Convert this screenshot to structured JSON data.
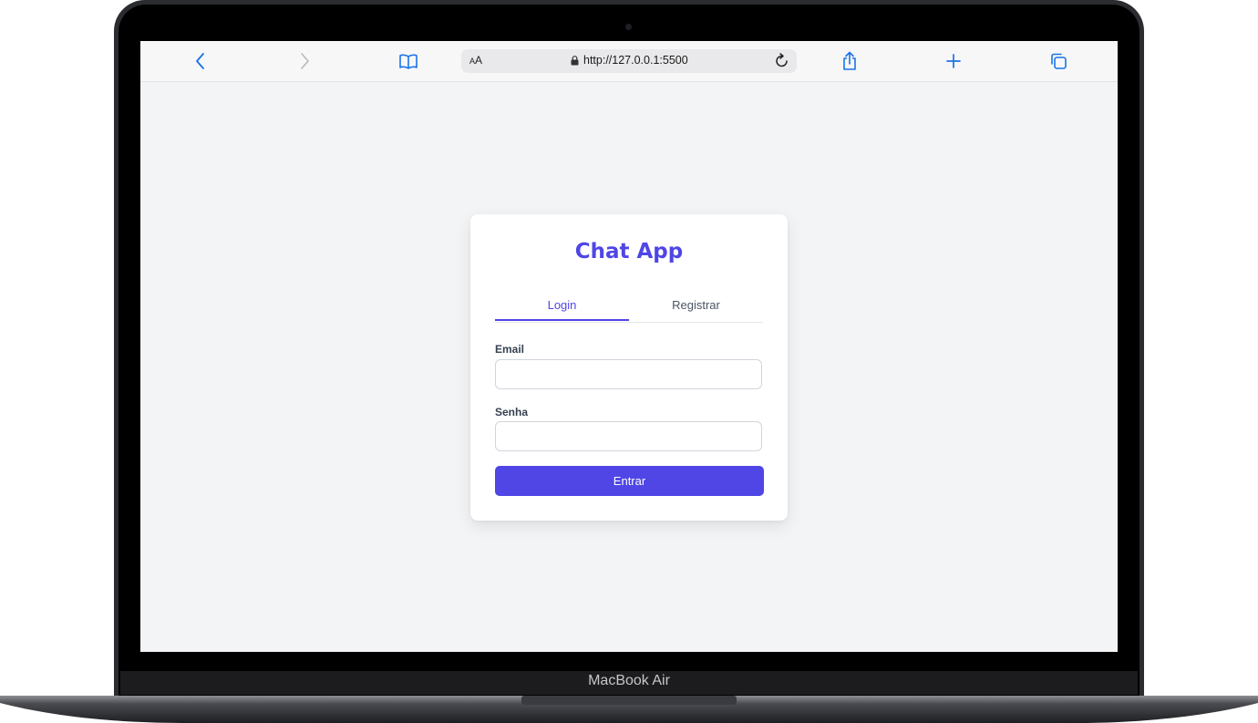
{
  "device": {
    "label": "MacBook Air"
  },
  "browser": {
    "text_size_small": "A",
    "text_size_large": "A",
    "url": "http://127.0.0.1:5500",
    "icons": [
      "chevron-left-icon",
      "chevron-right-icon",
      "book-icon",
      "lock-icon",
      "reload-icon",
      "share-icon",
      "plus-icon",
      "tabs-icon"
    ],
    "accent": "#1a73e8"
  },
  "app": {
    "title": "Chat App",
    "tabs": [
      {
        "label": "Login",
        "active": true
      },
      {
        "label": "Registrar",
        "active": false
      }
    ],
    "fields": [
      {
        "label": "Email",
        "value": "",
        "placeholder": ""
      },
      {
        "label": "Senha",
        "value": "",
        "placeholder": ""
      }
    ],
    "submit_label": "Entrar",
    "colors": {
      "primary": "#4f46e5",
      "background": "#f3f4f6",
      "card": "#ffffff"
    }
  }
}
